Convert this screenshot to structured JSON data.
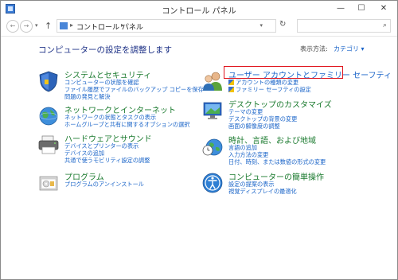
{
  "window": {
    "title": "コントロール パネル"
  },
  "title_controls": {
    "minimize": "—",
    "maximize": "☐",
    "close": "✕"
  },
  "address": {
    "crumb": "コントロール パネル",
    "sep": "▸",
    "sep2": "▸"
  },
  "nav": {
    "back": "←",
    "forward": "→",
    "dropdown": "▾",
    "up": "↑",
    "refresh": "↻"
  },
  "search": {
    "placeholder": ""
  },
  "header": {
    "title": "コンピューターの設定を調整します",
    "view_by_label": "表示方法:",
    "view_by_value": "カテゴリ ▾"
  },
  "categories": [
    {
      "title": "システムとセキュリティ",
      "links": [
        "コンピューターの状態を確認",
        "ファイル履歴でファイルのバックアップ コピーを保存",
        "問題の発見と解決"
      ]
    },
    {
      "title": "ネットワークとインターネット",
      "links": [
        "ネットワークの状態とタスクの表示",
        "ホームグループと共有に関するオプションの選択"
      ]
    },
    {
      "title": "ハードウェアとサウンド",
      "links": [
        "デバイスとプリンターの表示",
        "デバイスの追加",
        "共通で使うモビリティ設定の調整"
      ]
    },
    {
      "title": "プログラム",
      "links": [
        "プログラムのアンインストール"
      ]
    },
    {
      "title": "ユーザー アカウントとファミリー セーフティ",
      "links": [
        "アカウントの種類の変更",
        "ファミリー セーフティの設定"
      ]
    },
    {
      "title": "デスクトップのカスタマイズ",
      "links": [
        "テーマの変更",
        "デスクトップの背景の変更",
        "画面の解像度の調整"
      ]
    },
    {
      "title": "時計、言語、および地域",
      "links": [
        "言語の追加",
        "入力方法の変更",
        "日付、時刻、または数値の形式の変更"
      ]
    },
    {
      "title": "コンピューターの簡単操作",
      "links": [
        "設定の提案の表示",
        "視覚ディスプレイの最適化"
      ]
    }
  ]
}
